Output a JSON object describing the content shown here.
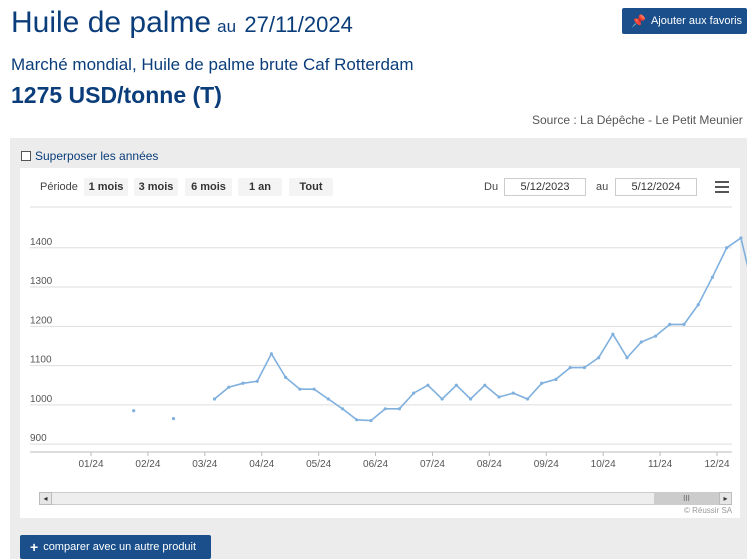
{
  "header": {
    "title": "Huile de palme",
    "date_prefix": "au",
    "date": "27/11/2024",
    "favorite_label": "Ajouter aux favoris",
    "subtitle": "Marché mondial, Huile de palme brute Caf Rotterdam",
    "price": "1275 USD/tonne (T)",
    "source": "Source : La Dépêche - Le Petit Meunier"
  },
  "chart_controls": {
    "overlay_label": "Superposer les années",
    "period_label": "Période",
    "ranges": [
      "1 mois",
      "3 mois",
      "6 mois",
      "1 an",
      "Tout"
    ],
    "from_label": "Du",
    "from_value": "5/12/2023",
    "to_label": "au",
    "to_value": "5/12/2024",
    "credits": "© Réussir SA",
    "scroll_thumb": "III",
    "scroll_left": "◂",
    "scroll_right": "▸"
  },
  "compare_label": "comparer avec un autre produit",
  "colors": {
    "line": "#7fb0de",
    "brand": "#1a4f8b",
    "title": "#0a3d7a"
  },
  "chart_data": {
    "type": "line",
    "title": "",
    "xlabel": "",
    "ylabel": "",
    "x_ticks": [
      "01/24",
      "02/24",
      "03/24",
      "04/24",
      "05/24",
      "06/24",
      "07/24",
      "08/24",
      "09/24",
      "10/24",
      "11/24",
      "12/24"
    ],
    "y_ticks": [
      900,
      1000,
      1100,
      1200,
      1300,
      1400
    ],
    "ylim": [
      880,
      1430
    ],
    "xlim": [
      0,
      11.4
    ],
    "grid": true,
    "series": [
      {
        "name": "",
        "points": [
          [
            0.75,
            985
          ],
          [
            1.45,
            965
          ],
          [
            2.17,
            1015
          ],
          [
            2.42,
            1045
          ],
          [
            2.67,
            1055
          ],
          [
            2.92,
            1060
          ],
          [
            3.17,
            1130
          ],
          [
            3.42,
            1070
          ],
          [
            3.67,
            1040
          ],
          [
            3.92,
            1040
          ],
          [
            4.17,
            1015
          ],
          [
            4.42,
            990
          ],
          [
            4.67,
            962
          ],
          [
            4.92,
            960
          ],
          [
            5.17,
            990
          ],
          [
            5.42,
            990
          ],
          [
            5.67,
            1030
          ],
          [
            5.92,
            1050
          ],
          [
            6.17,
            1015
          ],
          [
            6.42,
            1050
          ],
          [
            6.67,
            1015
          ],
          [
            6.92,
            1050
          ],
          [
            7.17,
            1020
          ],
          [
            7.42,
            1030
          ],
          [
            7.67,
            1015
          ],
          [
            7.92,
            1055
          ],
          [
            8.17,
            1065
          ],
          [
            8.42,
            1095
          ],
          [
            8.67,
            1095
          ],
          [
            8.92,
            1120
          ],
          [
            9.17,
            1180
          ],
          [
            9.42,
            1120
          ],
          [
            9.67,
            1160
          ],
          [
            9.92,
            1175
          ],
          [
            10.17,
            1205
          ],
          [
            10.42,
            1205
          ],
          [
            10.67,
            1255
          ],
          [
            10.92,
            1325
          ],
          [
            11.17,
            1400
          ],
          [
            11.42,
            1425
          ],
          [
            11.67,
            1275
          ]
        ]
      }
    ]
  }
}
